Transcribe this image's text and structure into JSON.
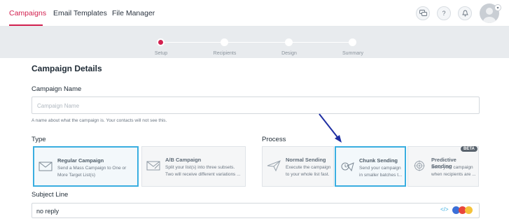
{
  "nav": {
    "tabs": [
      {
        "label": "Campaigns",
        "active": true
      },
      {
        "label": "Email Templates",
        "active": false
      },
      {
        "label": "File Manager",
        "active": false
      }
    ],
    "help_label": "?"
  },
  "stepper": {
    "steps": [
      {
        "label": "Setup",
        "active": true
      },
      {
        "label": "Recipients",
        "active": false
      },
      {
        "label": "Design",
        "active": false
      },
      {
        "label": "Summary",
        "active": false
      }
    ]
  },
  "main": {
    "title": "Campaign Details",
    "campaign_name": {
      "label": "Campaign Name",
      "placeholder": "Campaign Name",
      "hint": "A name about what the campaign is. Your contacts will not see this."
    },
    "type": {
      "label": "Type",
      "cards": [
        {
          "title": "Regular Campaign",
          "desc": "Send a Mass Campaign to One or More Target List(s)",
          "selected": true
        },
        {
          "title": "A/B Campaign",
          "desc": "Split your list(s) into three subsets. Two will receive different variations ...",
          "selected": false
        }
      ]
    },
    "process": {
      "label": "Process",
      "cards": [
        {
          "title": "Normal Sending",
          "desc": "Execute the campaign to your whole list fast.",
          "selected": false
        },
        {
          "title": "Chunk Sending",
          "desc": "Send your campaign in smaller batches t...",
          "selected": true
        },
        {
          "title": "Predictive Sending",
          "desc": "Send your campaign when recipients are ...",
          "selected": false,
          "badge": "BETA"
        }
      ]
    },
    "subject": {
      "label": "Subject Line",
      "value": "no reply",
      "code_icon": "</>"
    }
  },
  "colors": {
    "accent": "#d2204f",
    "selected_border": "#3aaee0",
    "annotation_arrow": "#1f2fa3"
  }
}
